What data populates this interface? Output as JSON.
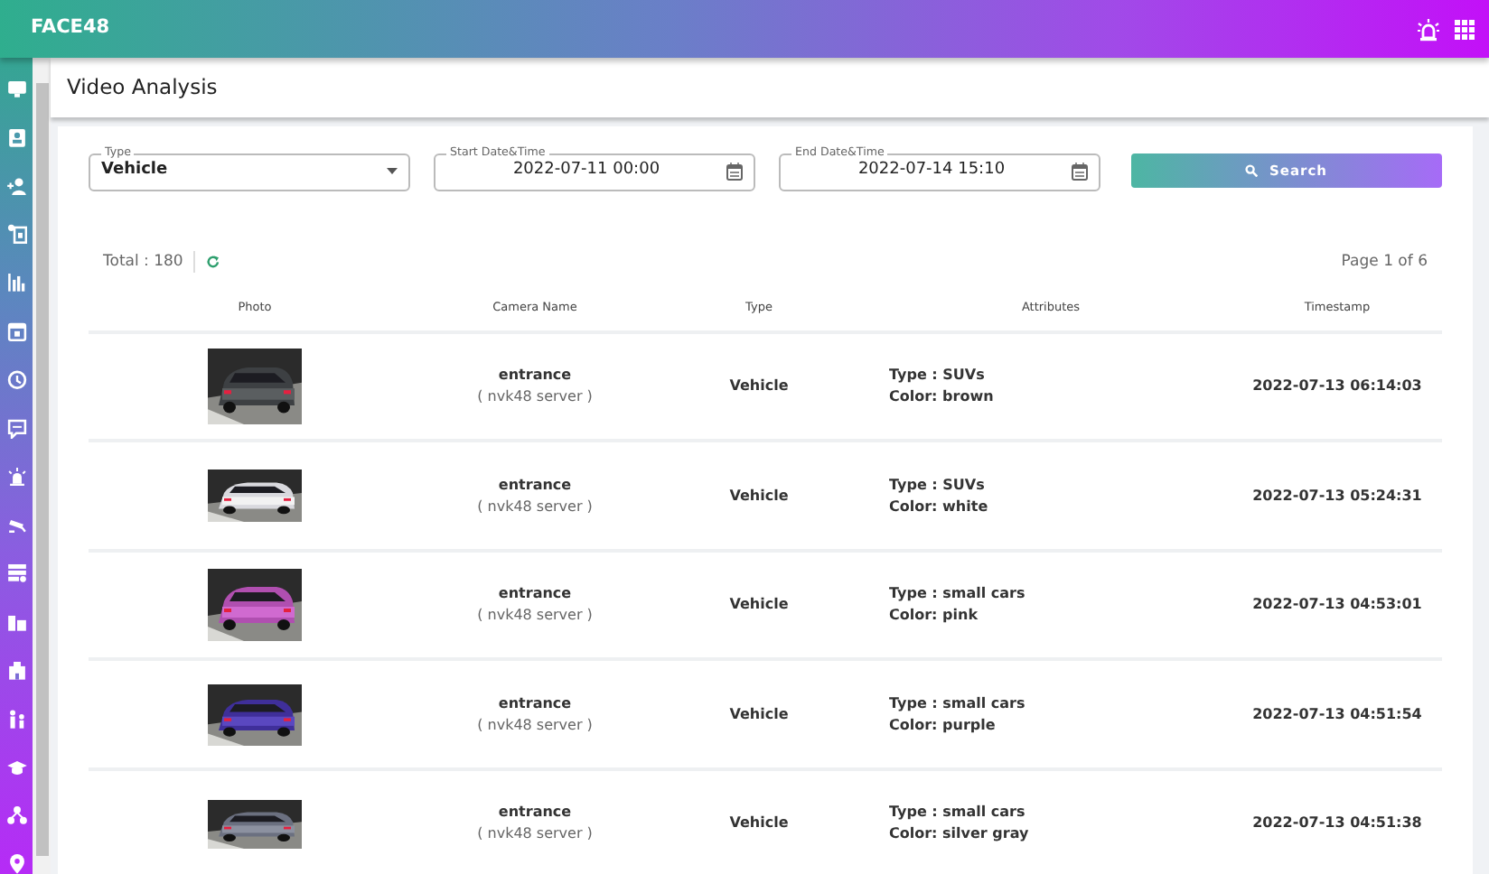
{
  "app": {
    "brand": "FACE48"
  },
  "page_title": "Video Analysis",
  "filters": [
    {
      "kind": "select",
      "label": "Type",
      "value": "Vehicle"
    },
    {
      "kind": "date",
      "label": "Start Date&Time",
      "value": "2022-07-11 00:00"
    },
    {
      "kind": "date",
      "label": "End Date&Time",
      "value": "2022-07-14 15:10"
    }
  ],
  "search_button": "Search",
  "total": "Total : 180",
  "pagination": "Page 1 of 6",
  "table": {
    "columns": [
      "Photo",
      "Camera Name",
      "Type",
      "Attributes",
      "Timestamp"
    ],
    "rows": [
      {
        "camera": "entrance",
        "server": "( nvk48 server )",
        "type": "Vehicle",
        "attr_type": "Type : SUVs",
        "attr_color": "Color: brown",
        "timestamp": "2022-07-13 06:14:03"
      },
      {
        "camera": "entrance",
        "server": "( nvk48 server )",
        "type": "Vehicle",
        "attr_type": "Type : SUVs",
        "attr_color": "Color: white",
        "timestamp": "2022-07-13 05:24:31"
      },
      {
        "camera": "entrance",
        "server": "( nvk48 server )",
        "type": "Vehicle",
        "attr_type": "Type : small cars",
        "attr_color": "Color: pink",
        "timestamp": "2022-07-13 04:53:01"
      },
      {
        "camera": "entrance",
        "server": "( nvk48 server )",
        "type": "Vehicle",
        "attr_type": "Type : small cars",
        "attr_color": "Color: purple",
        "timestamp": "2022-07-13 04:51:54"
      },
      {
        "camera": "entrance",
        "server": "( nvk48 server )",
        "type": "Vehicle",
        "attr_type": "Type : small cars",
        "attr_color": "Color: silver gray",
        "timestamp": "2022-07-13 04:51:38"
      }
    ]
  }
}
